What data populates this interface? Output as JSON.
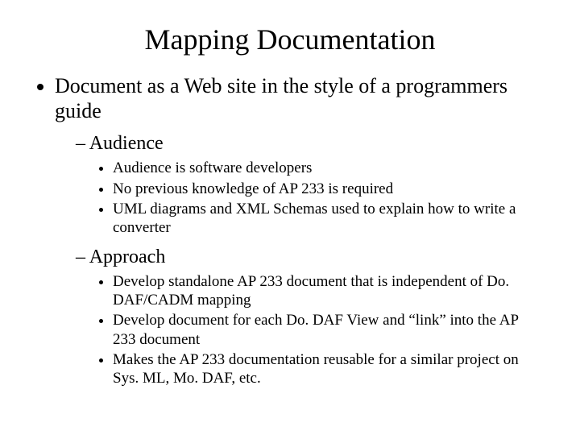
{
  "title": "Mapping Documentation",
  "bullets": {
    "main": "Document as a Web site in the style of a programmers guide",
    "sub": [
      {
        "label": "Audience",
        "items": [
          "Audience is software developers",
          "No previous knowledge of AP 233 is required",
          "UML diagrams and XML Schemas used to explain how to write a converter"
        ]
      },
      {
        "label": "Approach",
        "items": [
          "Develop standalone AP 233 document that is independent of Do. DAF/CADM mapping",
          "Develop document for each Do. DAF View and “link” into the AP 233 document",
          "Makes the AP 233 documentation reusable for a similar project on Sys. ML, Mo. DAF, etc."
        ]
      }
    ]
  }
}
